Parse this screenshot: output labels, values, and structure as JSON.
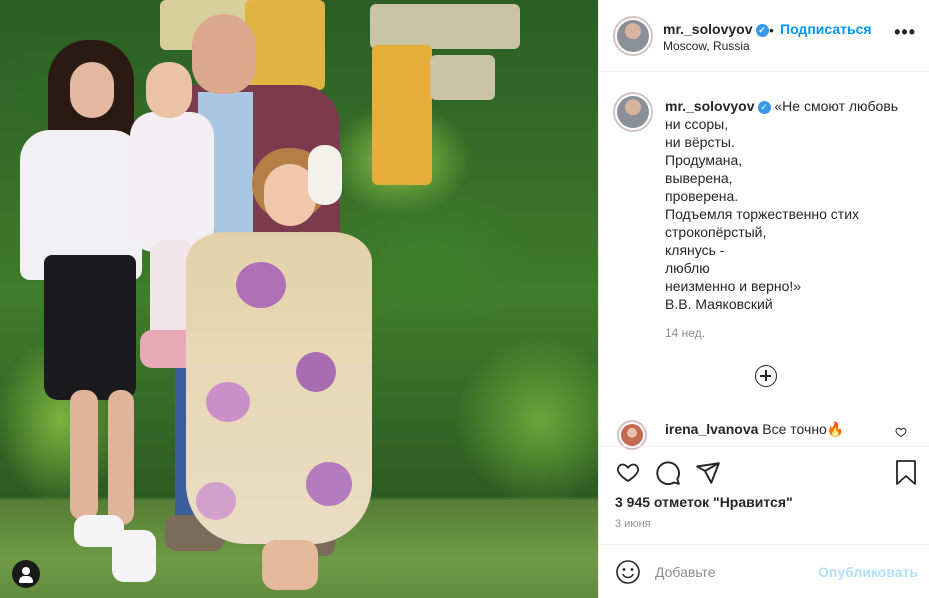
{
  "post": {
    "username": "mr._solovyov",
    "follow_label": "Подписаться",
    "dot": "•",
    "location": "Moscow, Russia",
    "more": "•••",
    "verified_glyph": "✓"
  },
  "caption": {
    "username": "mr._solovyov",
    "lines": [
      "«Не смоют любовь",
      "ни ссоры,",
      "ни вёрсты.",
      "Продумана,",
      "выверена,",
      "проверена.",
      "Подъемля торжественно стих",
      "строкопёрстый,",
      "клянусь -",
      "люблю",
      "неизменно и верно!»",
      "В.В. Маяковский"
    ],
    "age": "14 нед."
  },
  "comment": {
    "username": "irena_lvanova",
    "text": "Все точно🔥",
    "like_icon": "heart-outline-icon"
  },
  "actions": {
    "icons": [
      "heart-icon",
      "comment-icon",
      "share-icon",
      "bookmark-icon"
    ]
  },
  "likes_text": "3 945 отметок \"Нравится\"",
  "date": "3 июня",
  "add_comment": {
    "placeholder": "Добавьте",
    "publish_label": "Опубликовать"
  },
  "colors": {
    "accent": "#0095f6",
    "publish_disabled": "#b2dffc",
    "secondary_text": "#8e8e8e"
  }
}
